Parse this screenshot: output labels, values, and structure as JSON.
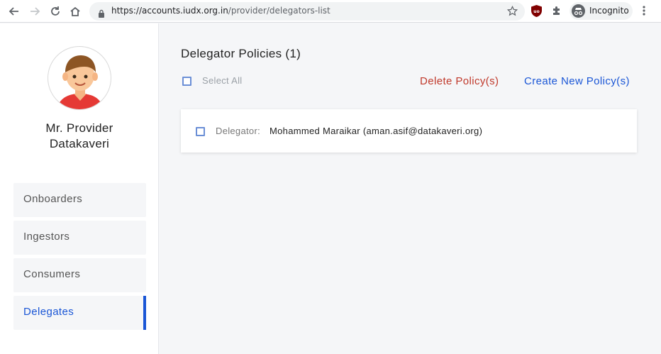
{
  "browser": {
    "url_host": "https://accounts.iudx.org.in",
    "url_path": "/provider/delegators-list",
    "incognito_label": "Incognito",
    "icons": [
      "back-icon",
      "forward-icon",
      "reload-icon",
      "home-icon",
      "lock-icon",
      "star-icon",
      "ublock-icon",
      "extensions-icon",
      "incognito-icon",
      "menu-icon"
    ]
  },
  "sidebar": {
    "user_name_line1": "Mr. Provider",
    "user_name_line2": "Datakaveri",
    "items": [
      {
        "label": "Onboarders",
        "active": false
      },
      {
        "label": "Ingestors",
        "active": false
      },
      {
        "label": "Consumers",
        "active": false
      },
      {
        "label": "Delegates",
        "active": true
      }
    ]
  },
  "main": {
    "title": "Delegator Policies (1)",
    "select_all_label": "Select All",
    "delete_label": "Delete Policy(s)",
    "create_label": "Create New Policy(s)",
    "policies": [
      {
        "label": "Delegator:",
        "value": "Mohammed Maraikar (aman.asif@datakaveri.org)"
      }
    ]
  },
  "colors": {
    "accent": "#1a56d6",
    "danger": "#c0392b",
    "background": "#f5f6f8"
  }
}
